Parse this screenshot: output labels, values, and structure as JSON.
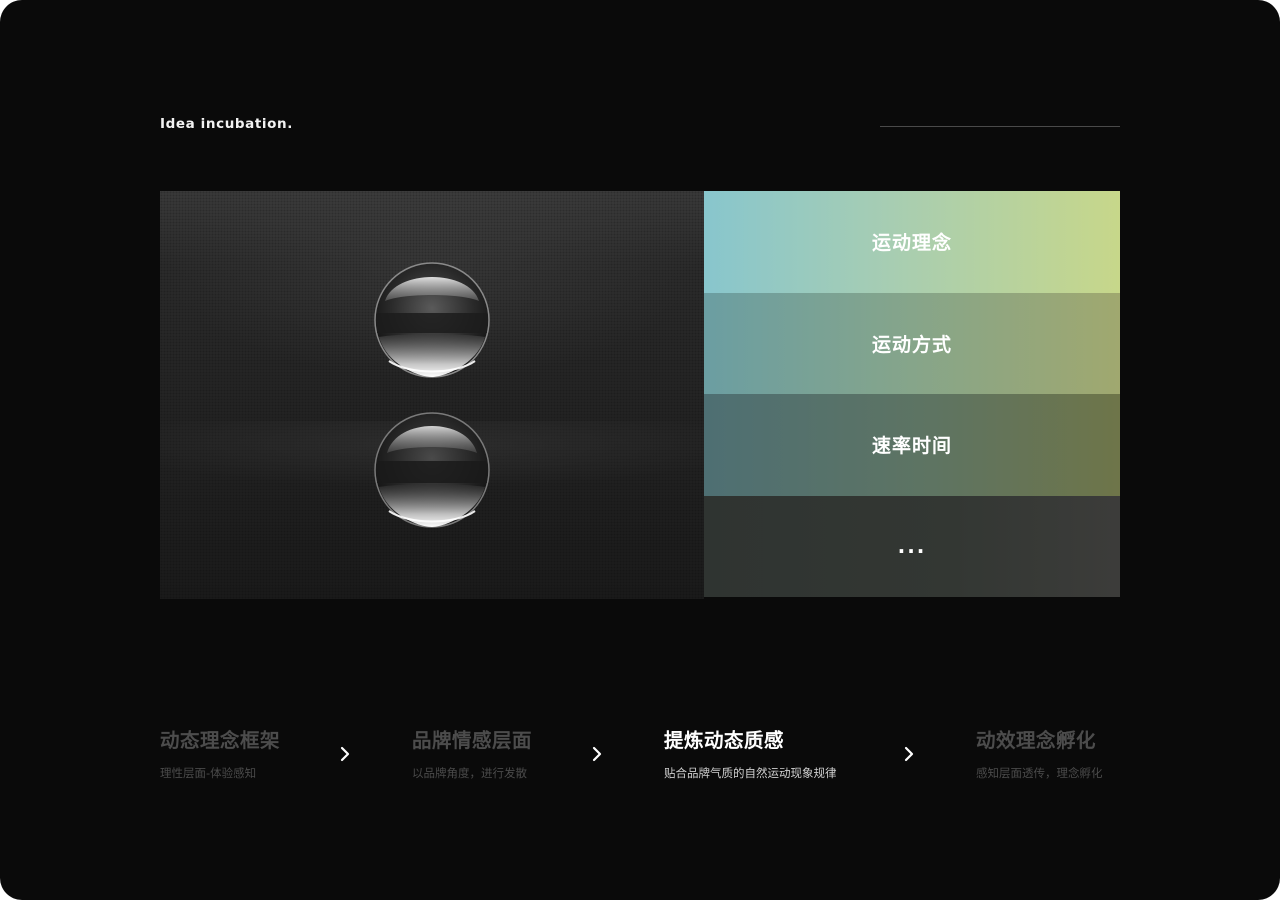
{
  "page": {
    "heading": "Idea incubation."
  },
  "stack": {
    "items": [
      {
        "label": "运动理念"
      },
      {
        "label": "运动方式"
      },
      {
        "label": "速率时间"
      },
      {
        "label": "..."
      }
    ]
  },
  "steps": [
    {
      "title": "动态理念框架",
      "desc": "理性层面-体验感知",
      "active": false
    },
    {
      "title": "品牌情感层面",
      "desc": "以品牌角度，进行发散",
      "active": false
    },
    {
      "title": "提炼动态质感",
      "desc": "贴合品牌气质的自然运动现象规律",
      "active": true
    },
    {
      "title": "动效理念孵化",
      "desc": "感知层面透传，理念孵化",
      "active": false
    }
  ],
  "icons": {
    "arrow": "chevron-right-icon",
    "sphere": "glass-sphere-icon"
  },
  "colors": {
    "background": "#0a0a0a",
    "active_text": "#ffffff",
    "inactive_text": "#4c4c4c",
    "gradient_top_start": "#88c6cd",
    "gradient_top_end": "#c7d78a"
  }
}
